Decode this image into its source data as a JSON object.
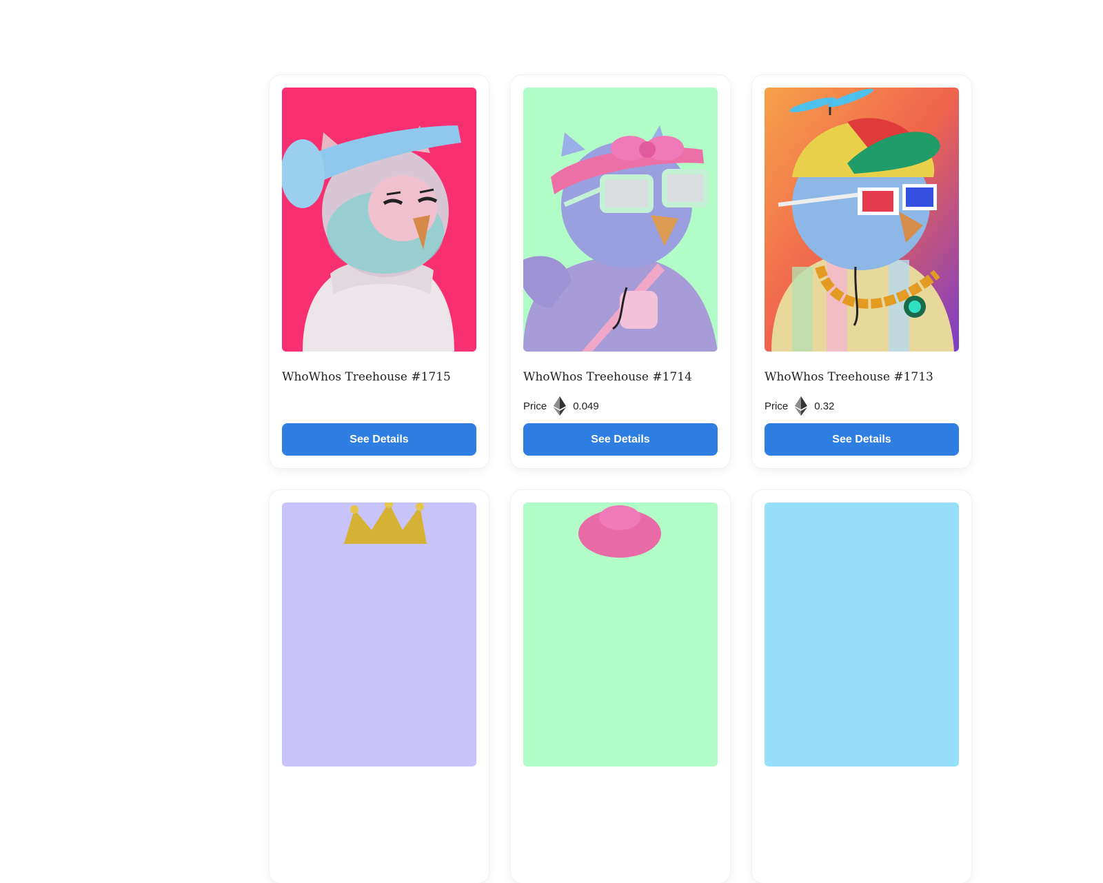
{
  "cards": [
    {
      "title": "WhoWhos Treehouse #1715",
      "price_label": "",
      "price": "",
      "button": "See Details",
      "bg": "#f82f70",
      "body": "#ece6ea",
      "head": "#b7d2df",
      "accessory": "headband-blue"
    },
    {
      "title": "WhoWhos Treehouse #1714",
      "price_label": "Price",
      "price": "0.049",
      "currency_icon": "ethereum-icon",
      "button": "See Details",
      "bg": "#b2fcc7",
      "body": "#a79bd8",
      "head": "#9a9fe0",
      "accessory": "pink-bow-glasses"
    },
    {
      "title": "WhoWhos Treehouse #1713",
      "price_label": "Price",
      "price": "0.32",
      "currency_icon": "ethereum-icon",
      "button": "See Details",
      "bg": "#f07b4e",
      "body": "#e8d89c",
      "head": "#8cb7e6",
      "accessory": "propeller-cap-chain"
    },
    {
      "title": "",
      "price_label": "",
      "price": "",
      "button": "",
      "bg": "#c8c4fb",
      "accessory": "crown"
    },
    {
      "title": "",
      "price_label": "",
      "price": "",
      "button": "",
      "bg": "#b2fcc7",
      "accessory": "pink-hat"
    },
    {
      "title": "",
      "price_label": "",
      "price": "",
      "button": "",
      "bg": "#96e0fb",
      "accessory": "none"
    }
  ],
  "colors": {
    "button": "#2f7fe2",
    "title": "#222222"
  }
}
